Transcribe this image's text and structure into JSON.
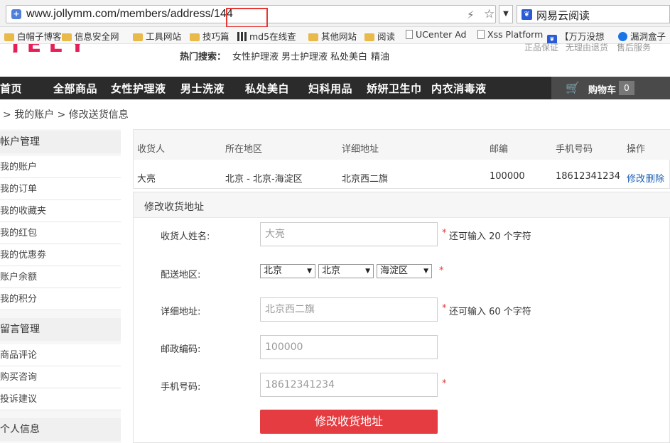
{
  "browser": {
    "url": "www.jollymm.com/members/address/144",
    "search_engine": "网易云阅读",
    "bookmarks": [
      "白帽子博客",
      "信息安全网",
      "工具网站",
      "技巧篇",
      "md5在线查",
      "其他网站",
      "阅读",
      "UCenter Ad",
      "Xss Platform",
      "【万万没想",
      "漏洞盒子"
    ]
  },
  "header": {
    "hot_label": "热门搜索：",
    "hot_items": [
      "女性护理液",
      "男士护理液",
      "私处美白",
      "精油"
    ],
    "guarantees": [
      "正品保证",
      "无理由退货",
      "售后服务"
    ]
  },
  "nav": {
    "items": [
      "首页",
      "全部商品",
      "女性护理液",
      "男士洗液",
      "私处美白",
      "妇科用品",
      "娇妍卫生巾",
      "内衣消毒液"
    ],
    "cart_label": "购物车",
    "cart_count": "0"
  },
  "breadcrumb": "> 我的账户 > 修改送货信息",
  "sidebar": {
    "sections": [
      {
        "title": "帐户管理",
        "items": [
          "我的账户",
          "我的订单",
          "我的收藏夹",
          "我的红包",
          "我的优惠劵",
          "账户余额",
          "我的积分"
        ]
      },
      {
        "title": "留言管理",
        "items": [
          "商品评论",
          "购买咨询",
          "投诉建议"
        ]
      },
      {
        "title": "个人信息",
        "items": []
      }
    ]
  },
  "address_table": {
    "headers": [
      "收货人",
      "所在地区",
      "详细地址",
      "邮编",
      "手机号码",
      "操作"
    ],
    "rows": [
      {
        "name": "大亮",
        "region": "北京 - 北京-海淀区",
        "address": "北京西二旗",
        "zip": "100000",
        "phone": "18612341234",
        "edit": "修改",
        "delete": "删除"
      }
    ]
  },
  "form": {
    "title": "修改收货地址",
    "name_label": "收货人姓名:",
    "name_value": "大亮",
    "name_hint": "还可输入 20 个字符",
    "region_label": "配送地区:",
    "province": "北京",
    "city": "北京",
    "district": "海淀区",
    "address_label": "详细地址:",
    "address_value": "北京西二旗",
    "address_hint": "还可输入 60 个字符",
    "zip_label": "邮政编码:",
    "zip_value": "100000",
    "phone_label": "手机号码:",
    "phone_value": "18612341234",
    "required_mark": "*",
    "submit_label": "修改收货地址"
  },
  "colors": {
    "accent": "#e43c41",
    "nav_bg": "#2b2b2b",
    "link": "#1a5fb4",
    "highlight_box": "#e53935"
  }
}
